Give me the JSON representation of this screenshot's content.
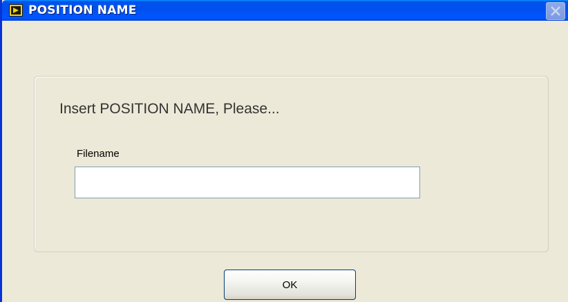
{
  "window": {
    "title": "POSITION NAME",
    "icon": "labview-vi-icon",
    "close_icon": "close-icon"
  },
  "dialog": {
    "prompt": "Insert POSITION NAME, Please...",
    "field_label": "Filename",
    "field_value": "",
    "ok_label": "OK"
  },
  "colors": {
    "titlebar": "#0055ee",
    "background": "#ece9d8",
    "input_border": "#7f9db9"
  }
}
